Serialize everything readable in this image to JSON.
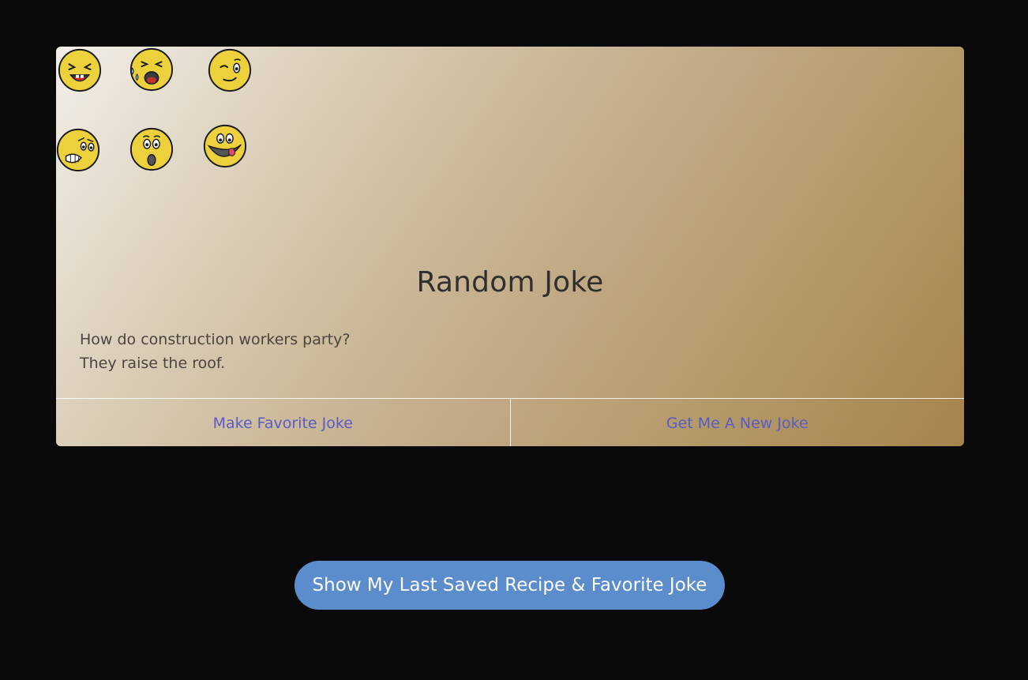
{
  "card": {
    "title": "Random Joke",
    "joke_setup": "How do construction workers party?",
    "joke_punchline": "They raise the roof.",
    "favorite_button_label": "Make Favorite Joke",
    "new_joke_button_label": "Get Me A New Joke"
  },
  "emojis": [
    "laughing-emoji-icon",
    "crying-laughing-emoji-icon",
    "winking-emoji-icon",
    "grimacing-emoji-icon",
    "surprised-emoji-icon",
    "tongue-out-emoji-icon"
  ],
  "show_saved_button_label": "Show My Last Saved Recipe & Favorite Joke",
  "colors": {
    "page_background": "#0a0a0a",
    "link_text": "#5a5bc4",
    "primary_button": "#5b8ccc",
    "emoji_yellow": "#ecd03c"
  }
}
